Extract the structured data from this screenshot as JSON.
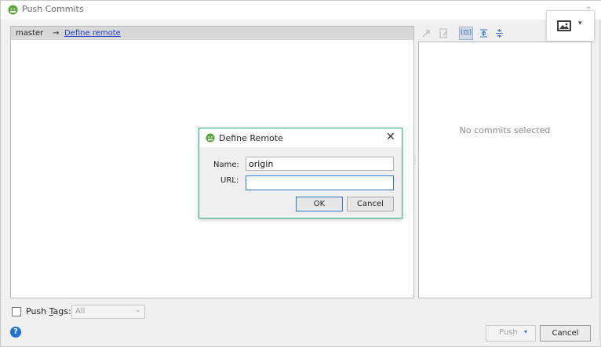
{
  "window": {
    "title": "Push Commits",
    "title_icon": "android-icon",
    "menu_chevron": "⌄"
  },
  "branch": {
    "local": "master",
    "arrow": "→",
    "remote_link": "Define remote"
  },
  "toolbar": {
    "icons": [
      "expand-icon",
      "edit-source-icon",
      "group-by-icon",
      "expand-all-icon",
      "collapse-all-icon"
    ],
    "group_glyph": "(⊡)",
    "expand_all_glyph": "⇞",
    "collapse_all_glyph": "⇟"
  },
  "image_menu": {
    "icon": "image-icon",
    "chevron": "▾"
  },
  "details": {
    "empty_text": "No commits selected"
  },
  "push_tags": {
    "checked": false,
    "label": "Push Tags:",
    "select_value": "All",
    "select_chevron": "⌄"
  },
  "footer": {
    "help_glyph": "?",
    "push_label": "Push",
    "push_chevron": "▾",
    "cancel_label": "Cancel"
  },
  "dialog": {
    "title": "Define Remote",
    "close_glyph": "✕",
    "name_label": "Name:",
    "name_value": "origin",
    "url_label": "URL:",
    "url_value": "",
    "ok_label": "OK",
    "cancel_label": "Cancel"
  },
  "colors": {
    "link": "#1a3ccc",
    "dialog_border": "#2fb07a",
    "focus": "#2a7ad4",
    "android_green": "#5aa43a"
  }
}
